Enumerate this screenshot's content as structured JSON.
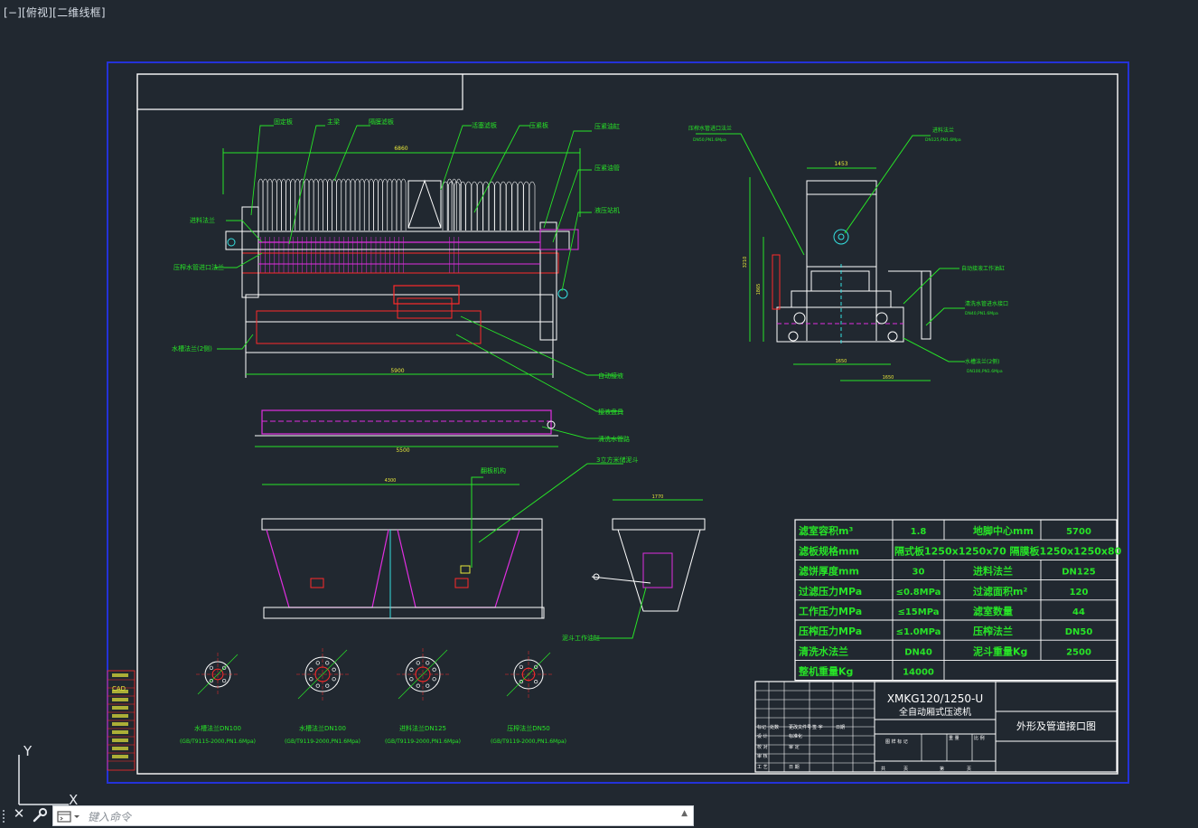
{
  "viewport": {
    "label": "[−][俯视][二维线框]"
  },
  "colors": {
    "background": "#212830",
    "frame": "#ffffff",
    "green": "#27e427",
    "magenta": "#e02ee0",
    "red": "#ff2a2a",
    "cyan": "#35e0e0",
    "yellow": "#e8e83a",
    "blue_border": "#2432d8"
  },
  "drawing": {
    "main_dims": {
      "overall": "6860",
      "bottom": "5900"
    },
    "side_dims": {
      "top": "1453",
      "left": "3210",
      "left_inner": "1865",
      "bottom1": "1650",
      "bottom2": "1650"
    },
    "tray_dim": "5500",
    "hopper_dim": "4300",
    "hopper2_dim": "1770",
    "spec": {
      "rows": [
        [
          "滤室容积m³",
          "1.8",
          "地脚中心mm",
          "5700"
        ],
        [
          "滤板规格mm",
          "隔式板1250x1250x70 隔膜板1250x1250x80",
          "",
          ""
        ],
        [
          "滤饼厚度mm",
          "30",
          "进料法兰",
          "DN125"
        ],
        [
          "过滤压力MPa",
          "≤0.8MPa",
          "过滤面积m²",
          "120"
        ],
        [
          "工作压力MPa",
          "≤15MPa",
          "滤室数量",
          "44"
        ],
        [
          "压榨压力MPa",
          "≤1.0MPa",
          "压榨法兰",
          "DN50"
        ],
        [
          "清洗水法兰",
          "DN40",
          "泥斗重量Kg",
          "2500"
        ],
        [
          "整机重量Kg",
          "14000",
          "",
          ""
        ]
      ]
    },
    "title_block": {
      "model": "XMKG120/1250-U",
      "name": "全自动厢式压滤机",
      "drawing_title": "外形及管道接口图",
      "label_cells": [
        "标记",
        "处数",
        "更改文件号",
        "签 字",
        "日期",
        "设 计",
        "标准化",
        "校 对",
        "审 定",
        "审 核",
        "工 艺",
        "日 期",
        "图 样 标 记",
        "重 量",
        "比 例",
        "共",
        "页",
        "第",
        "页"
      ]
    },
    "callouts": {
      "top": [
        "固定板",
        "主梁",
        "隔膜滤板",
        "活塞滤板",
        "压紧板",
        "压紧油缸",
        "压紧油管",
        "液压站机"
      ],
      "left": [
        "进料法兰",
        "压榨水管进口法兰",
        "水槽法兰(2侧)"
      ],
      "right": [
        "自动接液",
        "接液盘具",
        "清洗水管路"
      ],
      "side_top": [
        "压榨水管进口法兰",
        "进料法兰"
      ],
      "side_top_sub": [
        "DN50,PN1.6Mpa",
        "DN125,PN1.6Mpa"
      ],
      "side_right": [
        "自动接液工作油缸",
        "清洗水管进水接口",
        "水槽法兰(2侧)"
      ],
      "side_right_sub": [
        "DN40,PN1.6Mpa",
        "DN100,PN1.6Mpa"
      ],
      "hopper": [
        "翻板机构",
        "3立方米储泥斗",
        "泥斗工作油缸"
      ]
    },
    "flanges": [
      {
        "title": "水槽法兰DN100",
        "std": "(GB/T9115-2000,PN1.6Mpa)"
      },
      {
        "title": "水槽法兰DN100",
        "std": "(GB/T9119-2000,PN1.6Mpa)"
      },
      {
        "title": "进料法兰DN125",
        "std": "(GB/T9119-2000,PN1.6Mpa)"
      },
      {
        "title": "压榨法兰DN50",
        "std": "(GB/T9119-2000,PN1.6Mpa)"
      }
    ],
    "layer_legend": [
      "CAD"
    ]
  },
  "command_line": {
    "placeholder": "键入命令",
    "close_glyph": "✕"
  },
  "ucs": {
    "y_label": "Y",
    "x_label": "X"
  }
}
